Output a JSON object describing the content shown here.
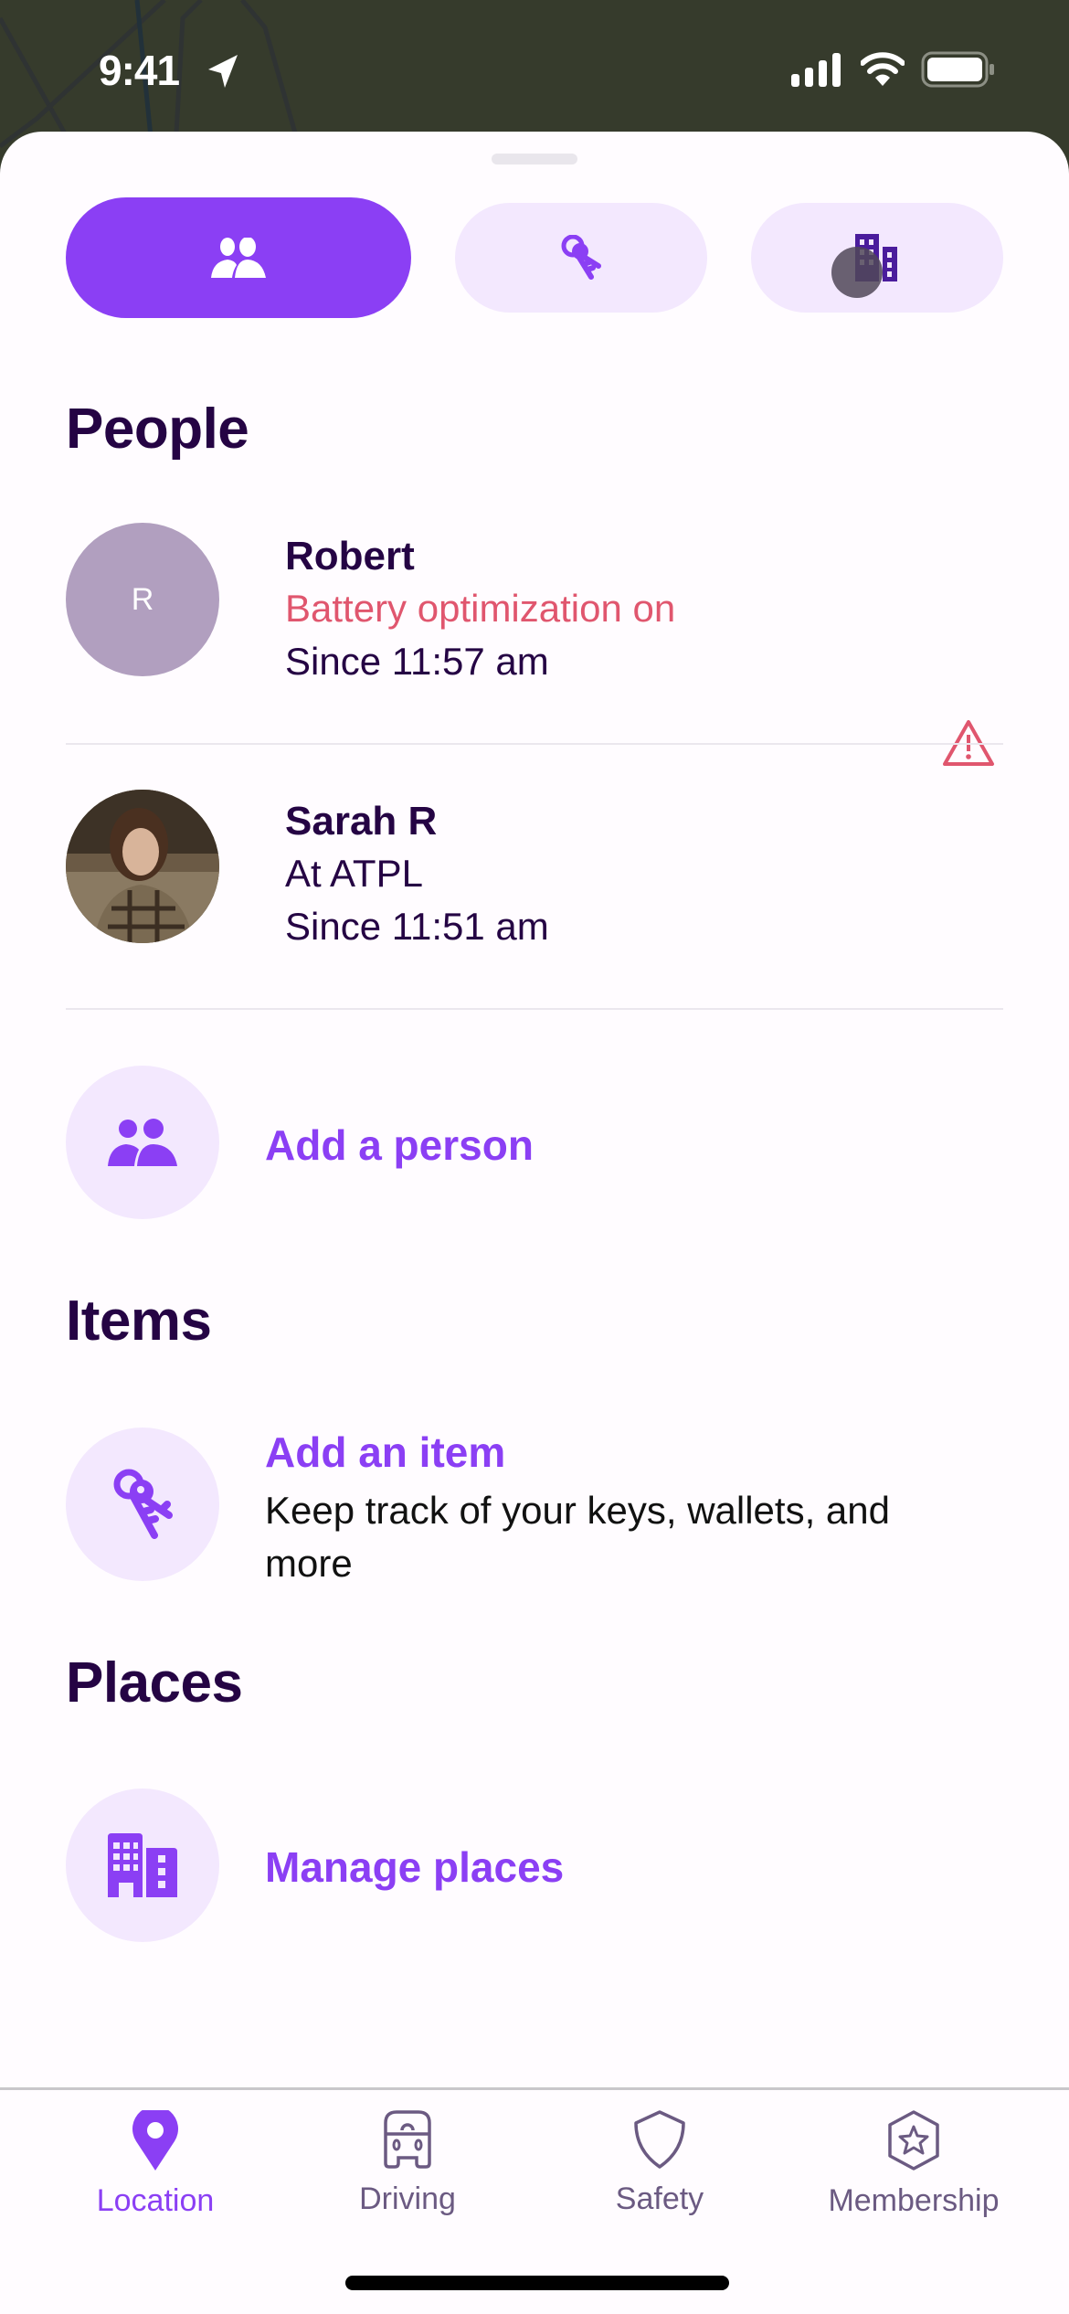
{
  "status_bar": {
    "time": "9:41"
  },
  "segments": [
    {
      "name": "people",
      "icon": "people-icon",
      "active": true
    },
    {
      "name": "items",
      "icon": "keys-icon",
      "active": false
    },
    {
      "name": "places",
      "icon": "building-icon",
      "active": false
    }
  ],
  "people_section": {
    "title": "People",
    "people": [
      {
        "name": "Robert",
        "initial": "R",
        "status": "Battery optimization on",
        "since": "Since 11:57 am",
        "warning": true
      },
      {
        "name": "Sarah R",
        "status": "At ATPL",
        "since": "Since 11:51 am",
        "warning": false
      }
    ],
    "add_label": "Add a person"
  },
  "items_section": {
    "title": "Items",
    "add_label": "Add an item",
    "add_desc": "Keep track of your keys, wallets, and more"
  },
  "places_section": {
    "title": "Places",
    "manage_label": "Manage places"
  },
  "tab_bar": {
    "tabs": [
      {
        "label": "Location",
        "icon": "location-pin-icon",
        "active": true
      },
      {
        "label": "Driving",
        "icon": "car-icon",
        "active": false
      },
      {
        "label": "Safety",
        "icon": "shield-icon",
        "active": false
      },
      {
        "label": "Membership",
        "icon": "star-badge-icon",
        "active": false
      }
    ]
  },
  "colors": {
    "accent": "#8b3ff4",
    "accent_light": "#f3e8fe",
    "heading": "#250444",
    "warning": "#e0566e"
  }
}
